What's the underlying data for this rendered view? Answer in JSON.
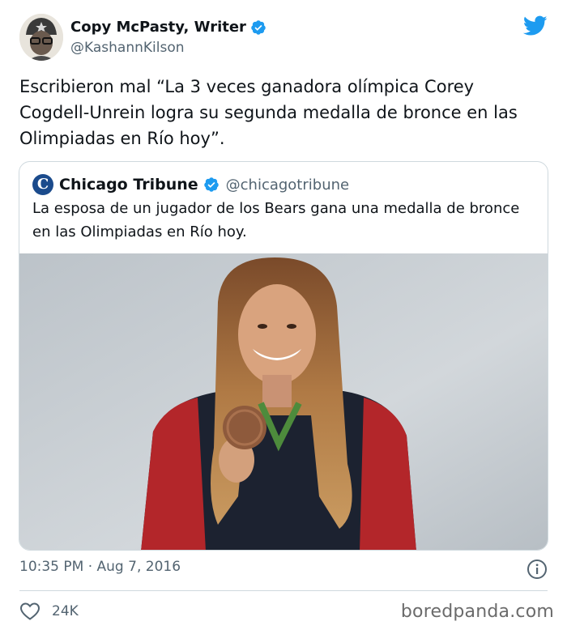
{
  "tweet": {
    "display_name": "Copy McPasty, Writer",
    "handle": "@KashannKilson",
    "text": "Escribieron mal “La 3 veces ganadora olímpica Corey Cogdell-Unrein logra su segunda medalla de bronce en las Olimpiadas en Río hoy”.",
    "timestamp": "10:35 PM · Aug 7, 2016",
    "likes": "24K"
  },
  "quoted_tweet": {
    "display_name": "Chicago Tribune",
    "handle": "@chicagotribune",
    "logo_letter": "C",
    "text": "La esposa de un jugador de los Bears gana una medalla de bronce en las Olimpiadas en Río hoy."
  },
  "icons": {
    "verified": "verified-badge-icon",
    "brand": "twitter-bird-icon",
    "info": "info-icon",
    "like": "heart-icon"
  },
  "colors": {
    "twitter_blue": "#1d9bf0",
    "secondary_text": "#536471",
    "border": "#cfd9de",
    "tribune_blue": "#1b4b8c"
  },
  "watermark": "boredpanda.com"
}
